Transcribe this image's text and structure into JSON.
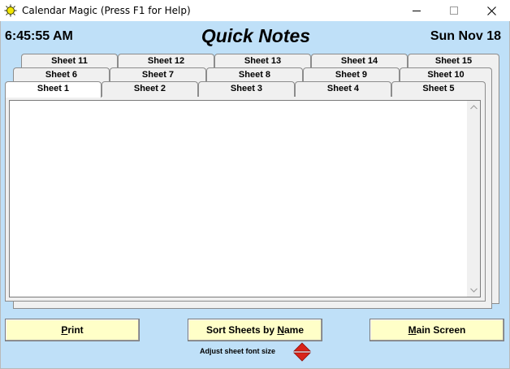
{
  "window": {
    "title": "Calendar Magic (Press F1 for Help)",
    "icon": "sun-icon"
  },
  "header": {
    "time": "6:45:55 AM",
    "title": "Quick Notes",
    "date": "Sun Nov 18"
  },
  "tabs": {
    "row_back": [
      "Sheet 11",
      "Sheet 12",
      "Sheet 13",
      "Sheet 14",
      "Sheet 15"
    ],
    "row_middle": [
      "Sheet 6",
      "Sheet 7",
      "Sheet 8",
      "Sheet 9",
      "Sheet 10"
    ],
    "row_front": [
      "Sheet 1",
      "Sheet 2",
      "Sheet 3",
      "Sheet 4",
      "Sheet 5"
    ],
    "active": "Sheet 1"
  },
  "note": {
    "content": ""
  },
  "buttons": {
    "print": {
      "pre": "",
      "key": "P",
      "post": "rint"
    },
    "sort": {
      "pre": "Sort Sheets by ",
      "key": "N",
      "post": "ame"
    },
    "main": {
      "pre": "",
      "key": "M",
      "post": "ain Screen"
    }
  },
  "font_control": {
    "label": "Adjust sheet font size",
    "icon": "up-down-arrows-icon"
  },
  "colors": {
    "background": "#bfe0f8",
    "button": "#ffffc8",
    "stepper_arrows": "#d9241a"
  }
}
